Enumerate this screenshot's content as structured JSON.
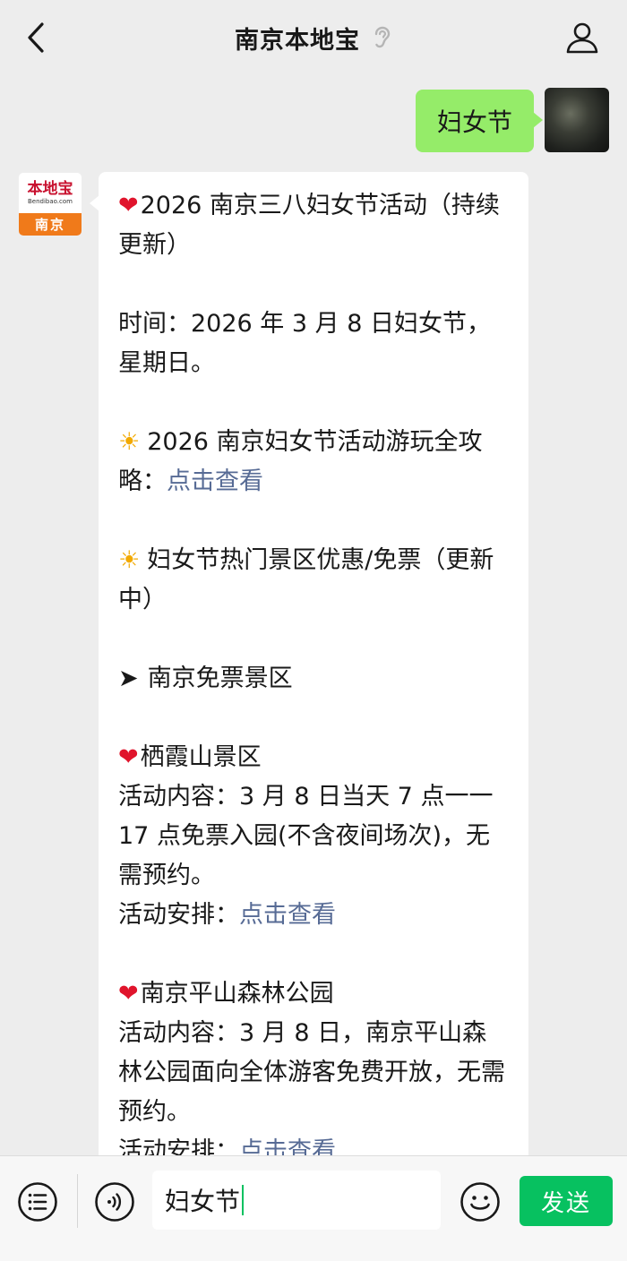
{
  "header": {
    "title": "南京本地宝"
  },
  "chat": {
    "sent": {
      "text": "妇女节"
    },
    "bot": {
      "avatar_main": "本地宝",
      "avatar_sub": "Bendibao.com",
      "avatar_city": "南京",
      "message": {
        "heading": "2026 南京三八妇女节活动（持续更新）",
        "time": "时间：2026 年 3 月 8 日妇女节，星期日。",
        "guide_prefix": "2026 南京妇女节活动游玩全攻略：",
        "guide_link": "点击查看",
        "hot_title": "妇女节热门景区优惠/免票（更新中）",
        "free_section": "南京免票景区",
        "spot1": {
          "name": "栖霞山景区",
          "content": "活动内容：3 月 8 日当天 7 点一一 17 点免票入园(不含夜间场次)，无需预约。",
          "arrange_prefix": "活动安排：",
          "arrange_link": "点击查看"
        },
        "spot2": {
          "name": "南京平山森林公园",
          "content": "活动内容：3 月 8 日，南京平山森林公园面向全体游客免费开放，无需预约。",
          "arrange_prefix": "活动安排：",
          "arrange_link": "点击查看"
        }
      }
    }
  },
  "input_bar": {
    "input_value": "妇女节",
    "send_label": "发送"
  },
  "colors": {
    "sent_bubble": "#95ec69",
    "link": "#576b95",
    "send_button": "#07c160",
    "background": "#ededed"
  },
  "icons": {
    "back": "chevron-left-icon",
    "ear": "ear-icon",
    "profile": "person-icon",
    "heart": "heart-icon",
    "sun": "sun-icon",
    "arrow": "arrow-right-icon",
    "menu": "list-menu-icon",
    "voice": "voice-icon",
    "emoji": "emoji-icon"
  }
}
